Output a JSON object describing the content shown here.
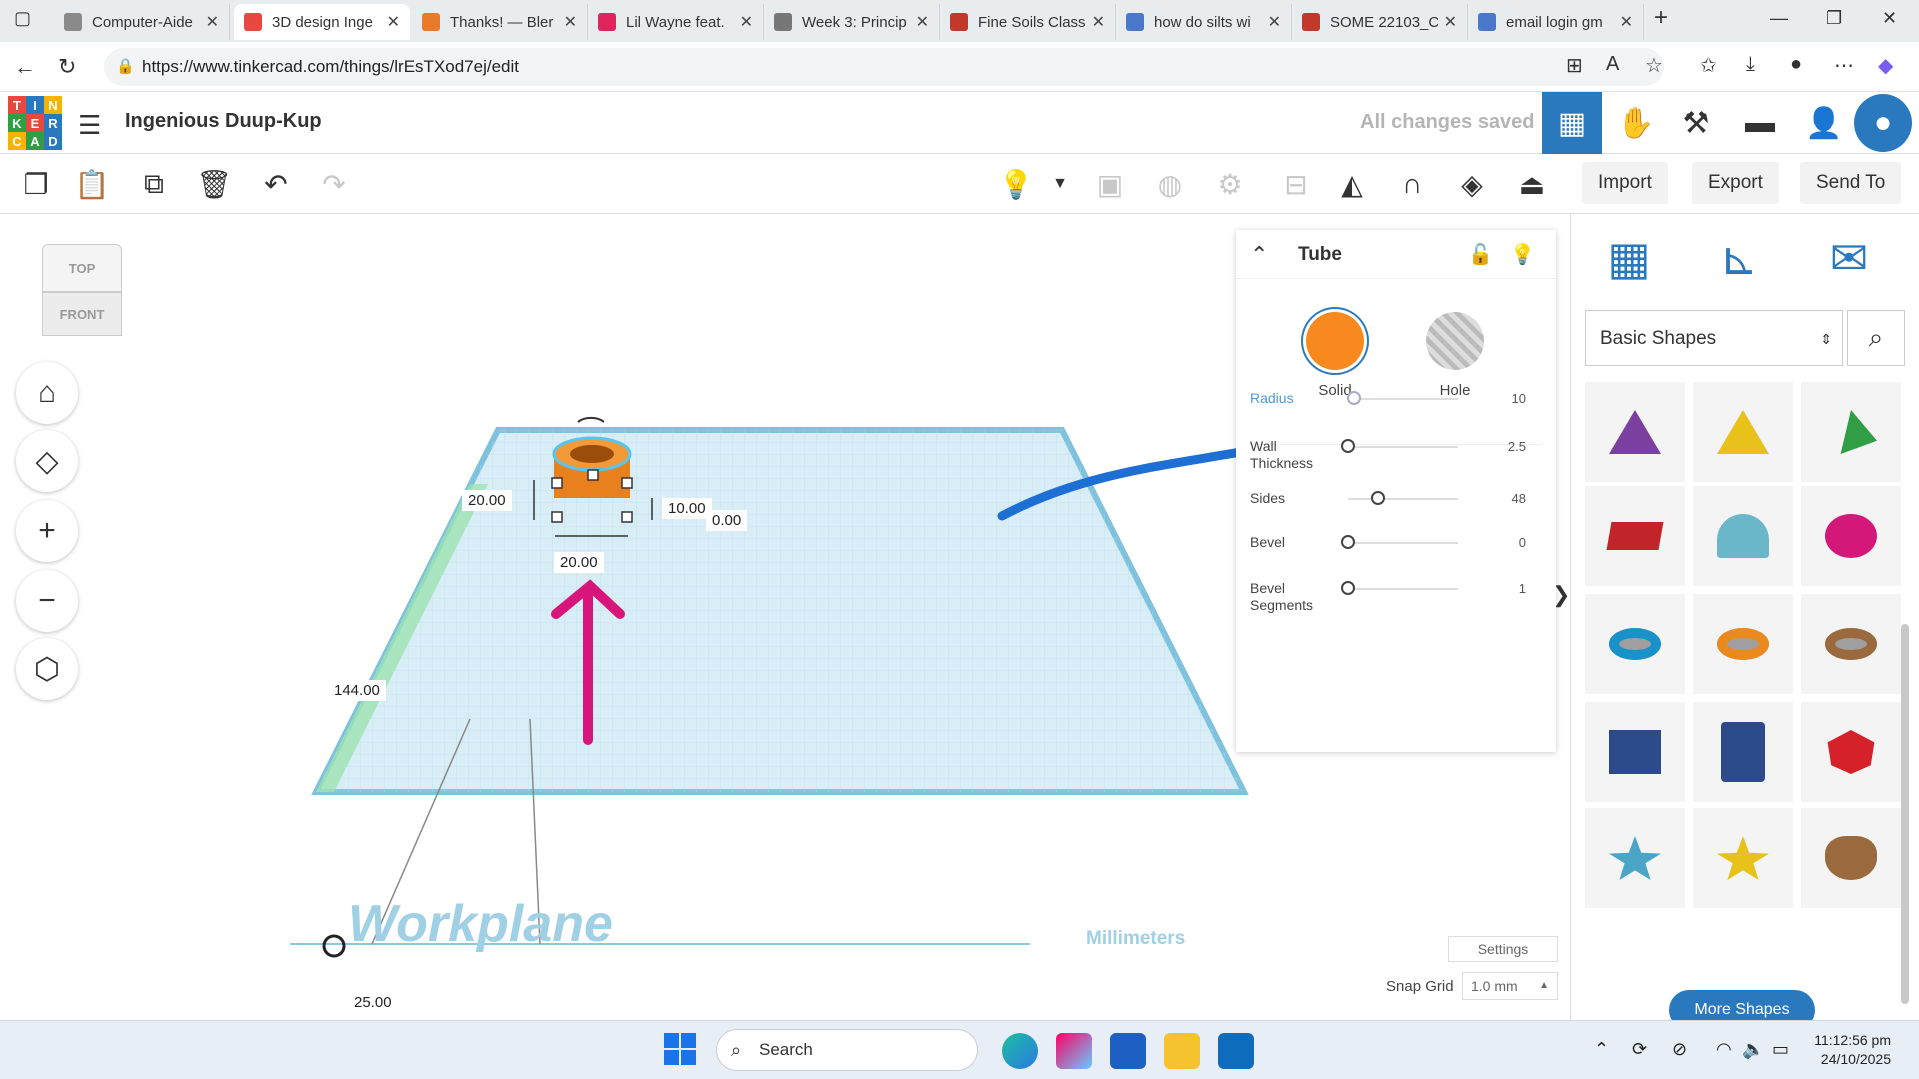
{
  "browser": {
    "tabs": [
      {
        "title": "Computer-Aide",
        "color": "#8a8a8a"
      },
      {
        "title": "3D design Inge",
        "color": "#e8483e",
        "active": true
      },
      {
        "title": "Thanks! — Bler",
        "color": "#e87a2a"
      },
      {
        "title": "Lil Wayne feat.",
        "color": "#e0245e"
      },
      {
        "title": "Week 3: Princip",
        "color": "#777777"
      },
      {
        "title": "Fine Soils Class",
        "color": "#c0392b"
      },
      {
        "title": "how do silts wi",
        "color": "#4a77c9"
      },
      {
        "title": "SOME 22103_C",
        "color": "#c0392b"
      },
      {
        "title": "email login gm",
        "color": "#4a77c9"
      }
    ],
    "url": "https://www.tinkercad.com/things/lrEsTXod7ej/edit"
  },
  "header": {
    "logo_letters": [
      "T",
      "I",
      "N",
      "K",
      "E",
      "R",
      "C",
      "A",
      "D"
    ],
    "design_name": "Ingenious Duup-Kup",
    "save_status": "All changes saved"
  },
  "toolbar": {
    "import_label": "Import",
    "export_label": "Export",
    "sendto_label": "Send To"
  },
  "viewcube": {
    "top_label": "TOP",
    "front_label": "FRONT"
  },
  "canvas": {
    "workplane_label": "Workplane",
    "units_label": "Millimeters",
    "dims": {
      "width": "20.00",
      "depth": "20.00",
      "height": "10.00",
      "elev": "0.00",
      "side": "144.00",
      "bottom": "25.00"
    },
    "settings_label": "Settings",
    "snap_label": "Snap Grid",
    "snap_value": "1.0 mm"
  },
  "inspector": {
    "title": "Tube",
    "solid_label": "Solid",
    "hole_label": "Hole",
    "solid_color": "#f7891e",
    "props": [
      {
        "label": "Radius",
        "value": "10",
        "fraction": 0.05
      },
      {
        "label": "Wall Thickness",
        "value": "2.5",
        "fraction": 0.0
      },
      {
        "label": "Sides",
        "value": "48",
        "fraction": 0.27
      },
      {
        "label": "Bevel",
        "value": "0",
        "fraction": 0.0
      },
      {
        "label": "Bevel Segments",
        "value": "1",
        "fraction": 0.0
      }
    ]
  },
  "shapes_panel": {
    "category": "Basic Shapes",
    "more_label": "More Shapes",
    "tiles": [
      {
        "name": "cone",
        "color": "#7b3fa0"
      },
      {
        "name": "pyramid",
        "color": "#e8c21a"
      },
      {
        "name": "roof",
        "color": "#2f9e44"
      },
      {
        "name": "text",
        "color": "#c2242a"
      },
      {
        "name": "half-cylinder",
        "color": "#6ab7c9"
      },
      {
        "name": "paraboloid",
        "color": "#d3187a"
      },
      {
        "name": "torus",
        "color": "#1992c9"
      },
      {
        "name": "tube",
        "color": "#ea8a1e"
      },
      {
        "name": "ring",
        "color": "#9a6a3e"
      },
      {
        "name": "polygon",
        "color": "#2d4a8a"
      },
      {
        "name": "hex-prism",
        "color": "#2d4a8a"
      },
      {
        "name": "icosahedron",
        "color": "#d6202a"
      },
      {
        "name": "star",
        "color": "#4aa5c6"
      },
      {
        "name": "star-gold",
        "color": "#e8c21a"
      },
      {
        "name": "heart",
        "color": "#9a6a3e"
      }
    ]
  },
  "taskbar": {
    "search_placeholder": "Search",
    "time": "11:12:56 pm",
    "date": "24/10/2025"
  }
}
